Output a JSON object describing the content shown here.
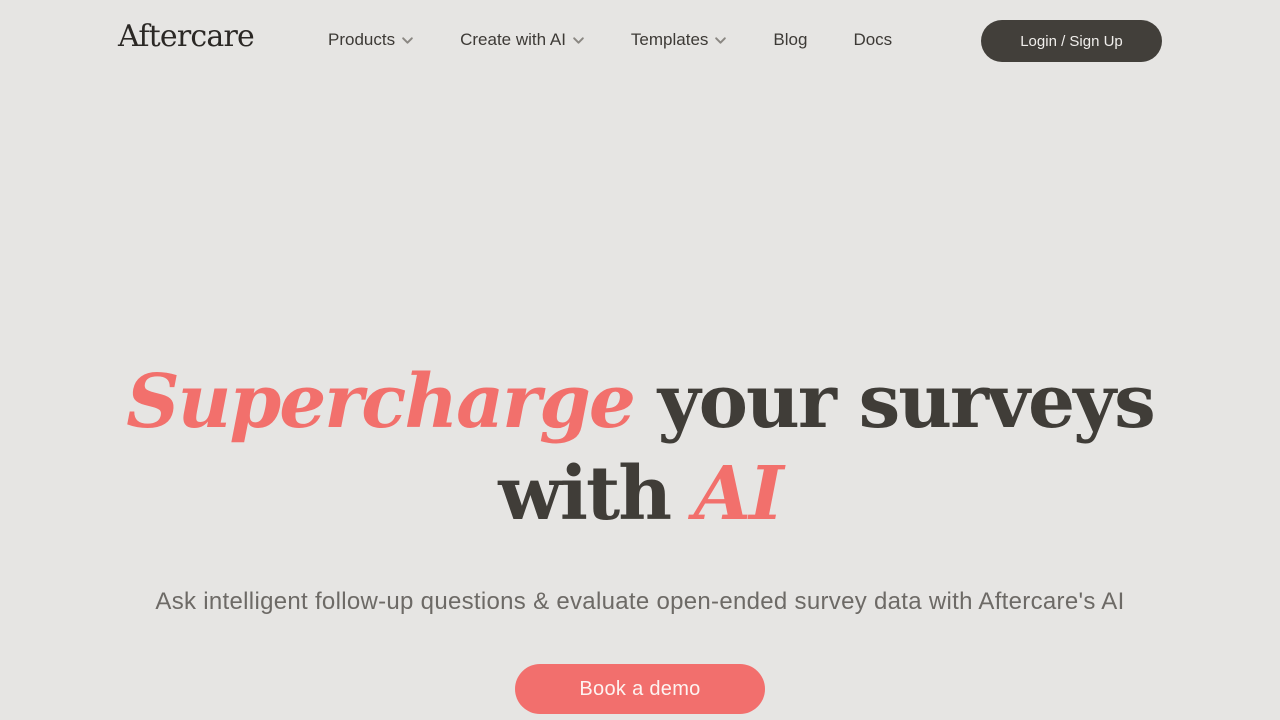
{
  "brand": {
    "name": "Aftercare"
  },
  "nav": {
    "items": [
      {
        "label": "Products",
        "dropdown": true
      },
      {
        "label": "Create with AI",
        "dropdown": true
      },
      {
        "label": "Templates",
        "dropdown": true
      },
      {
        "label": "Blog",
        "dropdown": false
      },
      {
        "label": "Docs",
        "dropdown": false
      }
    ],
    "login_label": "Login / Sign Up"
  },
  "hero": {
    "title_accent_1": "Supercharge",
    "title_plain_1": " your surveys",
    "title_plain_2": "with ",
    "title_accent_2": "AI",
    "subtitle": "Ask intelligent follow-up questions & evaluate open-ended survey data with Aftercare's AI",
    "cta_label": "Book a demo"
  },
  "colors": {
    "background": "#e6e5e3",
    "text_dark": "#403d38",
    "accent": "#f2706c",
    "login_button": "#423f3a"
  },
  "icons": {
    "dropdown": "chevron-down-icon"
  }
}
